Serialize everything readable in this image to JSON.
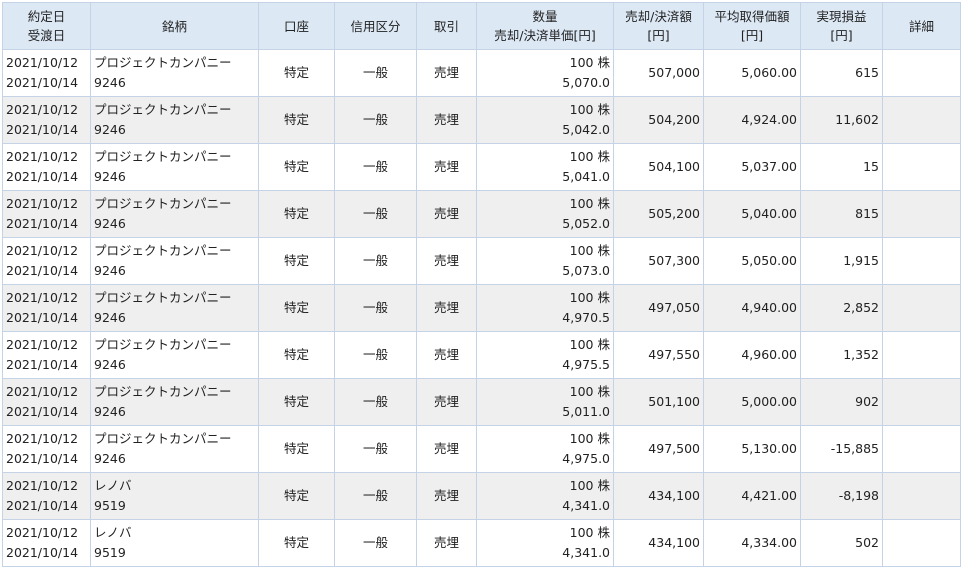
{
  "headers": {
    "date": [
      "約定日",
      "受渡日"
    ],
    "issue": "銘柄",
    "account": "口座",
    "credit": "信用区分",
    "trade": "取引",
    "quantity": [
      "数量",
      "売却/決済単価[円]"
    ],
    "amount": [
      "売却/決済額",
      "[円]"
    ],
    "avg": [
      "平均取得価額",
      "[円]"
    ],
    "pnl": [
      "実現損益",
      "[円]"
    ],
    "detail": "詳細"
  },
  "rows": [
    {
      "trade_date": "2021/10/12",
      "settle_date": "2021/10/14",
      "name": "プロジェクトカンパニー",
      "code": "9246",
      "account": "特定",
      "credit": "一般",
      "trade": "売埋",
      "qty": "100 株",
      "price": "5,070.0",
      "amount": "507,000",
      "avg": "5,060.00",
      "pnl": "615",
      "detail": ""
    },
    {
      "trade_date": "2021/10/12",
      "settle_date": "2021/10/14",
      "name": "プロジェクトカンパニー",
      "code": "9246",
      "account": "特定",
      "credit": "一般",
      "trade": "売埋",
      "qty": "100 株",
      "price": "5,042.0",
      "amount": "504,200",
      "avg": "4,924.00",
      "pnl": "11,602",
      "detail": ""
    },
    {
      "trade_date": "2021/10/12",
      "settle_date": "2021/10/14",
      "name": "プロジェクトカンパニー",
      "code": "9246",
      "account": "特定",
      "credit": "一般",
      "trade": "売埋",
      "qty": "100 株",
      "price": "5,041.0",
      "amount": "504,100",
      "avg": "5,037.00",
      "pnl": "15",
      "detail": ""
    },
    {
      "trade_date": "2021/10/12",
      "settle_date": "2021/10/14",
      "name": "プロジェクトカンパニー",
      "code": "9246",
      "account": "特定",
      "credit": "一般",
      "trade": "売埋",
      "qty": "100 株",
      "price": "5,052.0",
      "amount": "505,200",
      "avg": "5,040.00",
      "pnl": "815",
      "detail": ""
    },
    {
      "trade_date": "2021/10/12",
      "settle_date": "2021/10/14",
      "name": "プロジェクトカンパニー",
      "code": "9246",
      "account": "特定",
      "credit": "一般",
      "trade": "売埋",
      "qty": "100 株",
      "price": "5,073.0",
      "amount": "507,300",
      "avg": "5,050.00",
      "pnl": "1,915",
      "detail": ""
    },
    {
      "trade_date": "2021/10/12",
      "settle_date": "2021/10/14",
      "name": "プロジェクトカンパニー",
      "code": "9246",
      "account": "特定",
      "credit": "一般",
      "trade": "売埋",
      "qty": "100 株",
      "price": "4,970.5",
      "amount": "497,050",
      "avg": "4,940.00",
      "pnl": "2,852",
      "detail": ""
    },
    {
      "trade_date": "2021/10/12",
      "settle_date": "2021/10/14",
      "name": "プロジェクトカンパニー",
      "code": "9246",
      "account": "特定",
      "credit": "一般",
      "trade": "売埋",
      "qty": "100 株",
      "price": "4,975.5",
      "amount": "497,550",
      "avg": "4,960.00",
      "pnl": "1,352",
      "detail": ""
    },
    {
      "trade_date": "2021/10/12",
      "settle_date": "2021/10/14",
      "name": "プロジェクトカンパニー",
      "code": "9246",
      "account": "特定",
      "credit": "一般",
      "trade": "売埋",
      "qty": "100 株",
      "price": "5,011.0",
      "amount": "501,100",
      "avg": "5,000.00",
      "pnl": "902",
      "detail": ""
    },
    {
      "trade_date": "2021/10/12",
      "settle_date": "2021/10/14",
      "name": "プロジェクトカンパニー",
      "code": "9246",
      "account": "特定",
      "credit": "一般",
      "trade": "売埋",
      "qty": "100 株",
      "price": "4,975.0",
      "amount": "497,500",
      "avg": "5,130.00",
      "pnl": "-15,885",
      "detail": ""
    },
    {
      "trade_date": "2021/10/12",
      "settle_date": "2021/10/14",
      "name": "レノバ",
      "code": "9519",
      "account": "特定",
      "credit": "一般",
      "trade": "売埋",
      "qty": "100 株",
      "price": "4,341.0",
      "amount": "434,100",
      "avg": "4,421.00",
      "pnl": "-8,198",
      "detail": ""
    },
    {
      "trade_date": "2021/10/12",
      "settle_date": "2021/10/14",
      "name": "レノバ",
      "code": "9519",
      "account": "特定",
      "credit": "一般",
      "trade": "売埋",
      "qty": "100 株",
      "price": "4,341.0",
      "amount": "434,100",
      "avg": "4,334.00",
      "pnl": "502",
      "detail": ""
    }
  ]
}
